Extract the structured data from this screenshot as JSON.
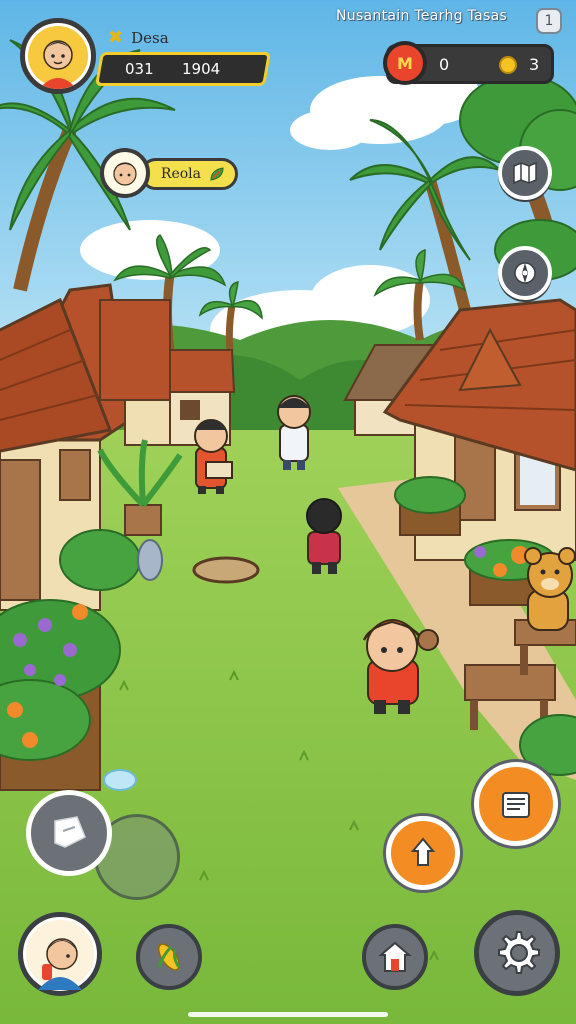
{
  "player": {
    "name": "Desa",
    "stat_left": "031",
    "stat_right": "1904"
  },
  "npc": {
    "name": "Reola"
  },
  "game_title": "Nusantain Tearhg Tasas",
  "top_corner_button": "1",
  "currency": {
    "medal_value": "0",
    "medal_glyph": "M",
    "coin_value": "3"
  },
  "right_menu": [
    "map-icon",
    "settings-gear-icon"
  ],
  "actions": {
    "joystick": "joystick",
    "chat": "chat-bubble-icon",
    "interact": "hand-pointer-icon",
    "inventory": "scroll-icon"
  },
  "bottom_bar": [
    "player-portrait",
    "corn-icon",
    "house-icon",
    "settings-gear-icon"
  ],
  "colors": {
    "sky": "#7ec8ea",
    "grass": "#86c63f",
    "path": "#e6c79a",
    "roof": "#b5522c",
    "accent_yellow": "#f2cd2b",
    "orange_button": "#f28c23"
  }
}
